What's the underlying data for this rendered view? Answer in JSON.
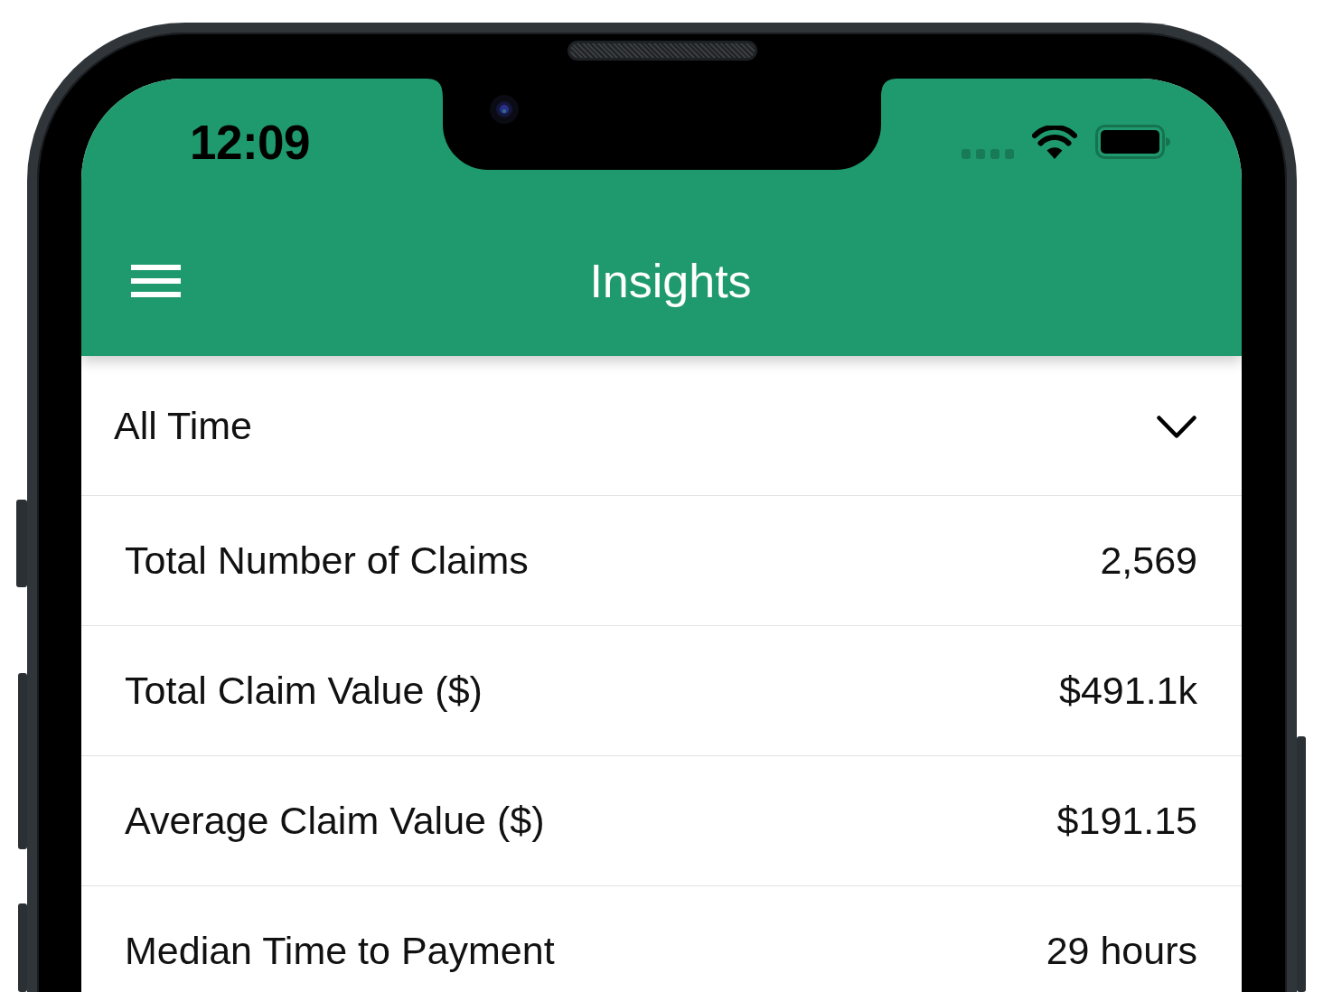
{
  "status_bar": {
    "time": "12:09"
  },
  "app_bar": {
    "title": "Insights"
  },
  "period_dropdown": {
    "value": "All Time"
  },
  "metrics": [
    {
      "label": "Total Number of Claims",
      "value": "2,569"
    },
    {
      "label": "Total Claim Value ($)",
      "value": "$491.1k"
    },
    {
      "label": "Average Claim Value ($)",
      "value": "$191.15"
    },
    {
      "label": "Median Time to Payment",
      "value": "29 hours"
    }
  ]
}
